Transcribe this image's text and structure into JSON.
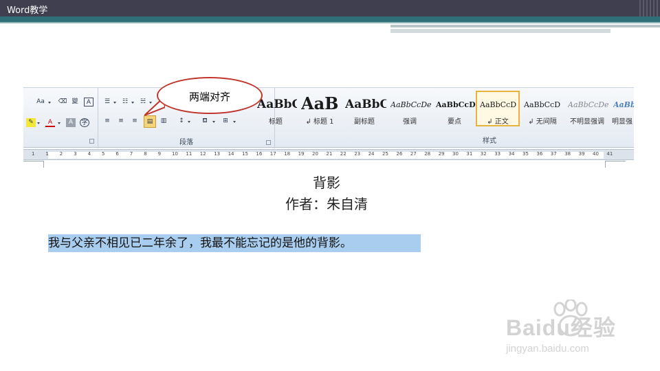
{
  "slide": {
    "title": "Word教学"
  },
  "ribbon": {
    "font_group": {
      "aa_label": "Aa",
      "phonetic_label": "變",
      "charborder_label": "A",
      "fontcolor_label": "A",
      "shading_label": "A",
      "enclose_label": "字"
    },
    "paragraph_group": {
      "label": "段落"
    },
    "styles_group": {
      "label": "样式",
      "items": [
        {
          "sample": "AaBbC",
          "name": "标题"
        },
        {
          "sample": "AaB",
          "name": "↲ 标题 1"
        },
        {
          "sample": "AaBbC",
          "name": "副标题"
        },
        {
          "sample": "AaBbCcDe",
          "name": "强调"
        },
        {
          "sample": "AaBbCcD",
          "name": "要点"
        },
        {
          "sample": "AaBbCcD",
          "name": "↲ 正文"
        },
        {
          "sample": "AaBbCcD",
          "name": "↲ 无间隔"
        },
        {
          "sample": "AaBbCcDe",
          "name": "不明显强调"
        },
        {
          "sample": "AaBbC",
          "name": "明显强"
        }
      ],
      "active_index": 5
    }
  },
  "ruler": {
    "numbers": [
      "1",
      "1",
      "2",
      "3",
      "4",
      "5",
      "6",
      "7",
      "8",
      "9",
      "10",
      "11",
      "12",
      "13",
      "14",
      "15",
      "16",
      "17",
      "18",
      "19",
      "20",
      "21",
      "22",
      "23",
      "24",
      "25",
      "26",
      "27",
      "28",
      "29",
      "30",
      "31",
      "32",
      "33",
      "34",
      "35",
      "36",
      "37",
      "38",
      "39",
      "40",
      "41"
    ]
  },
  "callout": {
    "text": "两端对齐"
  },
  "document": {
    "title": "背影",
    "author": "作者：朱自清",
    "paragraph": "我与父亲不相见已二年余了，我最不能忘记的是他的背影。"
  },
  "watermark": {
    "logo": "Baidu经验",
    "url": "jingyan.baidu.com"
  },
  "colors": {
    "header_bg": "#3f3f4f",
    "accent_teal": "#2f6f78",
    "selection": "#a9cdef",
    "callout_border": "#c0352b",
    "active_style_border": "#e8b33a"
  }
}
